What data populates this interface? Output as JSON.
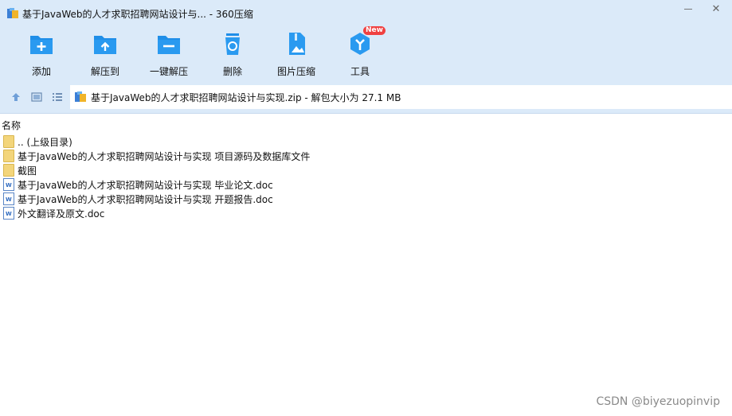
{
  "window": {
    "title": "基于JavaWeb的人才求职招聘网站设计与... - 360压缩",
    "minimize_glyph": "—",
    "close_glyph": "✕"
  },
  "toolbar": {
    "items": [
      {
        "label": "添加",
        "icon": "add-icon"
      },
      {
        "label": "解压到",
        "icon": "extract-to-icon"
      },
      {
        "label": "一键解压",
        "icon": "one-click-extract-icon"
      },
      {
        "label": "删除",
        "icon": "delete-icon"
      },
      {
        "label": "图片压缩",
        "icon": "image-compress-icon"
      },
      {
        "label": "工具",
        "icon": "tools-icon",
        "badge": "New"
      }
    ],
    "accent": "#1f8ee8"
  },
  "address": {
    "path": "基于JavaWeb的人才求职招聘网站设计与实现.zip - 解包大小为 27.1 MB"
  },
  "list": {
    "column_name": "名称",
    "rows": [
      {
        "name": ".. (上级目录)",
        "type": "folder"
      },
      {
        "name": "基于JavaWeb的人才求职招聘网站设计与实现 项目源码及数据库文件",
        "type": "folder"
      },
      {
        "name": "截图",
        "type": "folder"
      },
      {
        "name": "基于JavaWeb的人才求职招聘网站设计与实现 毕业论文.doc",
        "type": "doc"
      },
      {
        "name": "基于JavaWeb的人才求职招聘网站设计与实现 开题报告.doc",
        "type": "doc"
      },
      {
        "name": "外文翻译及原文.doc",
        "type": "doc"
      }
    ]
  },
  "watermark": "CSDN @biyezuopinvip"
}
